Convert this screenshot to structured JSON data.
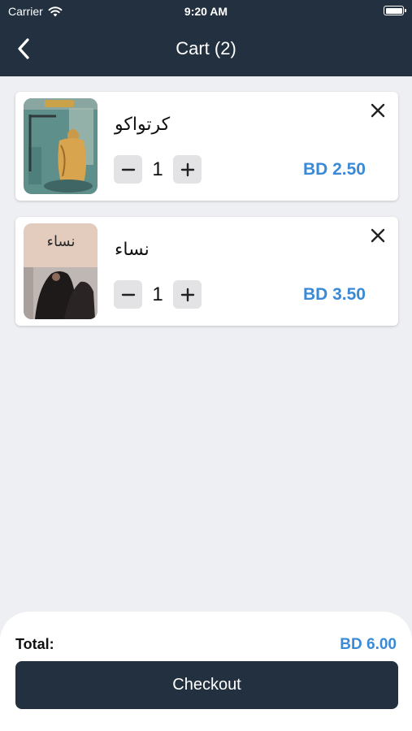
{
  "status_bar": {
    "carrier": "Carrier",
    "time": "9:20 AM"
  },
  "header": {
    "title": "Cart (2)"
  },
  "cart": {
    "items": [
      {
        "title": "كرتواكو",
        "quantity": "1",
        "price": "BD 2.50"
      },
      {
        "title": "نساء",
        "quantity": "1",
        "price": "BD 3.50"
      }
    ]
  },
  "icons": {
    "back": "chevron-left-icon",
    "remove": "close-icon",
    "decrement": "minus-icon",
    "increment": "plus-icon"
  },
  "colors": {
    "header_bg": "#22303f",
    "accent": "#3b8ad6",
    "page_bg": "#eeeff2"
  },
  "footer": {
    "total_label": "Total:",
    "total_value": "BD 6.00",
    "checkout_label": "Checkout"
  },
  "book2_cover_text": "نساء"
}
